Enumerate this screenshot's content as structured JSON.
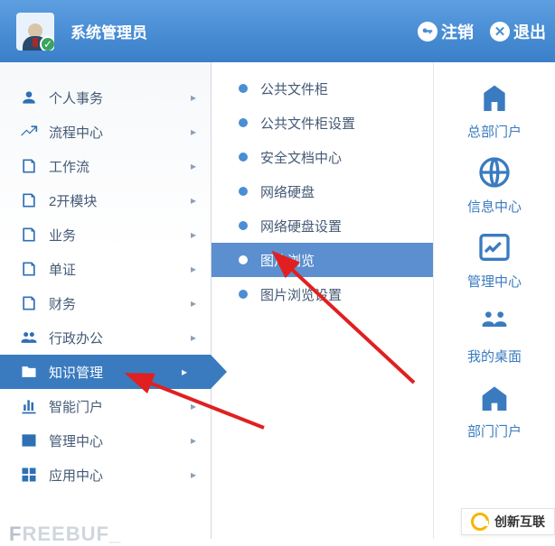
{
  "header": {
    "username": "系统管理员",
    "logout_label": "注销",
    "exit_label": "退出"
  },
  "nav": {
    "items": [
      {
        "label": "个人事务",
        "has_sub": true,
        "active": false,
        "icon": "person"
      },
      {
        "label": "流程中心",
        "has_sub": true,
        "active": false,
        "icon": "flow"
      },
      {
        "label": "工作流",
        "has_sub": true,
        "active": false,
        "icon": "page"
      },
      {
        "label": "2开模块",
        "has_sub": true,
        "active": false,
        "icon": "page"
      },
      {
        "label": "业务",
        "has_sub": true,
        "active": false,
        "icon": "page"
      },
      {
        "label": "单证",
        "has_sub": true,
        "active": false,
        "icon": "page"
      },
      {
        "label": "财务",
        "has_sub": true,
        "active": false,
        "icon": "page"
      },
      {
        "label": "行政办公",
        "has_sub": true,
        "active": false,
        "icon": "people"
      },
      {
        "label": "知识管理",
        "has_sub": true,
        "active": true,
        "icon": "folder-lock"
      },
      {
        "label": "智能门户",
        "has_sub": true,
        "active": false,
        "icon": "chart"
      },
      {
        "label": "管理中心",
        "has_sub": true,
        "active": false,
        "icon": "chart-box"
      },
      {
        "label": "应用中心",
        "has_sub": true,
        "active": false,
        "icon": "grid"
      }
    ]
  },
  "submenu": {
    "items": [
      {
        "label": "公共文件柜",
        "active": false
      },
      {
        "label": "公共文件柜设置",
        "active": false
      },
      {
        "label": "安全文档中心",
        "active": false
      },
      {
        "label": "网络硬盘",
        "active": false
      },
      {
        "label": "网络硬盘设置",
        "active": false
      },
      {
        "label": "图片浏览",
        "active": true
      },
      {
        "label": "图片浏览设置",
        "active": false
      }
    ]
  },
  "portals": [
    {
      "label": "总部门户",
      "icon": "building"
    },
    {
      "label": "信息中心",
      "icon": "globe"
    },
    {
      "label": "管理中心",
      "icon": "chart-box"
    },
    {
      "label": "我的桌面",
      "icon": "people-grid"
    },
    {
      "label": "部门门户",
      "icon": "house"
    }
  ],
  "watermark": "FREEBUF",
  "brand": "创新互联"
}
